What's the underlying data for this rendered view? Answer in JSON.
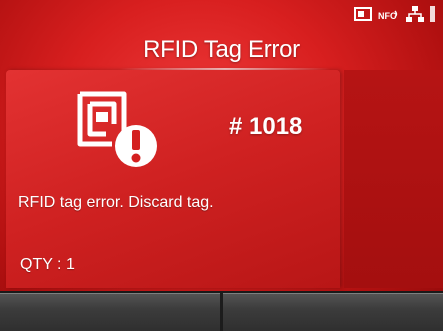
{
  "title": "RFID Tag Error",
  "error": {
    "number": "# 1018",
    "message": "RFID tag error. Discard tag."
  },
  "quantity_label": "QTY : 1",
  "status_icons": [
    "sd-card-icon",
    "nfc-icon",
    "network-icon",
    "battery-icon"
  ],
  "softkeys": [
    "",
    ""
  ],
  "colors": {
    "background": "#d81f1f",
    "panel": "#e33232",
    "text": "#ffffff",
    "softkey": "#3c3c3c"
  }
}
